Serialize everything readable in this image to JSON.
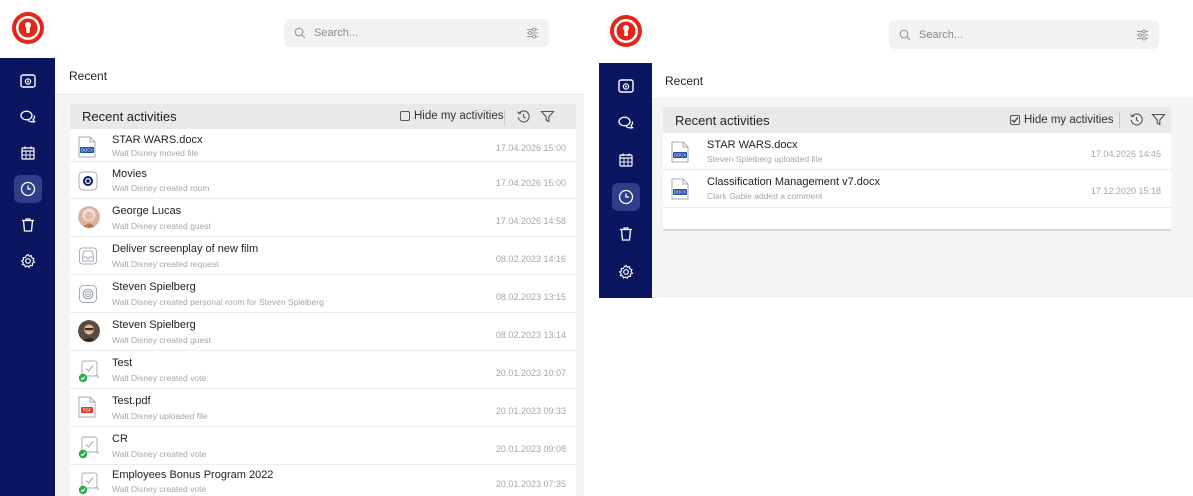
{
  "search": {
    "placeholder": "Search..."
  },
  "breadcrumb": "Recent",
  "card": {
    "title": "Recent activities",
    "hide_label": "Hide my activities"
  },
  "colors": {
    "sidebar": "#0b1660",
    "sidebar_active": "#2c3f88",
    "logo_red": "#e32619",
    "docx_blue": "#1f4fa8",
    "pdf_red": "#e2352a",
    "success_green": "#2fa84f"
  },
  "left": {
    "activities": [
      {
        "icon": "docx-file-icon",
        "title": "STAR WARS.docx",
        "subtitle": "Walt Disney moved file",
        "time": "17.04.2026 15:00"
      },
      {
        "icon": "room-icon",
        "title": "Movies",
        "subtitle": "Walt Disney created room",
        "time": "17.04.2026 15:00"
      },
      {
        "icon": "guest-avatar",
        "title": "George Lucas",
        "subtitle": "Walt Disney created guest",
        "time": "17.04.2026 14:58"
      },
      {
        "icon": "request-icon",
        "title": "Deliver screenplay of new film",
        "subtitle": "Walt Disney created request",
        "time": "08.02.2023 14:16"
      },
      {
        "icon": "personal-room-icon",
        "title": "Steven Spielberg",
        "subtitle": "Walt Disney created personal room for Steven Spielberg",
        "time": "08.02.2023 13:15"
      },
      {
        "icon": "guest-avatar",
        "title": "Steven Spielberg",
        "subtitle": "Walt Disney created guest",
        "time": "08.02.2023 13:14"
      },
      {
        "icon": "vote-icon",
        "title": "Test",
        "subtitle": "Walt Disney created vote",
        "time": "20.01.2023 10:07"
      },
      {
        "icon": "pdf-file-icon",
        "title": "Test.pdf",
        "subtitle": "Walt Disney uploaded file",
        "time": "20.01.2023 09:33"
      },
      {
        "icon": "vote-icon",
        "title": "CR",
        "subtitle": "Walt Disney created vote",
        "time": "20.01.2023 09:08"
      },
      {
        "icon": "vote-icon",
        "title": "Employees Bonus Program 2022",
        "subtitle": "Walt Disney created vote",
        "time": "20.01.2023 07:35"
      }
    ]
  },
  "right": {
    "hide_checked": true,
    "activities": [
      {
        "icon": "docx-file-icon",
        "title": "STAR WARS.docx",
        "subtitle": "Steven Spielberg uploaded file",
        "time": "17.04.2026 14:45"
      },
      {
        "icon": "docx-file-icon",
        "title": "Classification Management v7.docx",
        "subtitle": "Clark Gable added a comment",
        "time": "17.12.2020 15:18"
      }
    ]
  }
}
